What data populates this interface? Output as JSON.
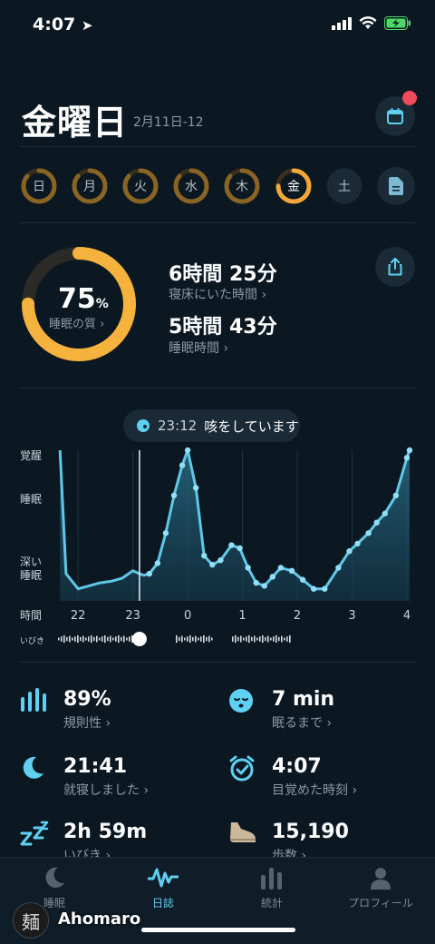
{
  "status_bar": {
    "time": "4:07"
  },
  "header": {
    "title": "金曜日",
    "date_range": "2月11日-12"
  },
  "week": {
    "days": [
      {
        "label": "日",
        "fraction": 0.86
      },
      {
        "label": "月",
        "fraction": 0.86
      },
      {
        "label": "火",
        "fraction": 0.86
      },
      {
        "label": "水",
        "fraction": 0.86
      },
      {
        "label": "木",
        "fraction": 0.86
      },
      {
        "label": "金",
        "fraction": 0.75,
        "active": true
      },
      {
        "label": "土",
        "fraction": 0
      }
    ]
  },
  "summary": {
    "quality_value": "75",
    "quality_unit": "%",
    "quality_fraction": 0.75,
    "quality_label": "睡眠の質 ›",
    "time_in_bed": "6時間 25分",
    "time_in_bed_label": "寝床にいた時間 ›",
    "time_asleep": "5時間 43分",
    "time_asleep_label": "睡眠時間 ›"
  },
  "event": {
    "time": "23:12",
    "text": "咳をしています"
  },
  "chart_data": {
    "type": "area",
    "y_categories": [
      "覚醒",
      "睡眠",
      "深い睡眠"
    ],
    "x_ticks": [
      "22",
      "23",
      "0",
      "1",
      "2",
      "3",
      "4"
    ],
    "xlabel": "時間",
    "snore_label": "いびき",
    "ylim": [
      0,
      100
    ],
    "x_hours": [
      21.67,
      21.78,
      22.0,
      22.2,
      22.4,
      22.6,
      22.8,
      23.0,
      23.12,
      23.2,
      23.3,
      23.45,
      23.6,
      23.75,
      23.9,
      24.0,
      24.15,
      24.3,
      24.45,
      24.6,
      24.8,
      24.95,
      25.1,
      25.25,
      25.4,
      25.55,
      25.7,
      25.9,
      26.1,
      26.3,
      26.5,
      26.75,
      26.95,
      27.1,
      27.3,
      27.45,
      27.6,
      27.8,
      28.0,
      28.05
    ],
    "values": [
      100,
      18,
      8,
      10,
      12,
      13,
      15,
      20,
      18,
      17,
      18,
      25,
      45,
      70,
      90,
      100,
      75,
      30,
      24,
      27,
      37,
      35,
      22,
      12,
      10,
      16,
      22,
      20,
      14,
      8,
      8,
      22,
      33,
      38,
      45,
      52,
      58,
      70,
      95,
      100
    ]
  },
  "metrics": [
    {
      "icon": "regularity-icon",
      "value": "89%",
      "label": "規則性 ›"
    },
    {
      "icon": "sleepy-face-icon",
      "value": "7 min",
      "label": "眠るまで ›"
    },
    {
      "icon": "moon-icon",
      "value": "21:41",
      "label": "就寝しました ›"
    },
    {
      "icon": "alarm-clock-icon",
      "value": "4:07",
      "label": "目覚めた時刻 ›"
    },
    {
      "icon": "snore-zzz-icon",
      "value": "2h 59m",
      "label": "いびき ›"
    },
    {
      "icon": "shoe-icon",
      "value": "15,190",
      "label": "歩数 ›"
    }
  ],
  "tabs": [
    {
      "label": "睡眠",
      "icon": "moon-icon"
    },
    {
      "label": "日誌",
      "icon": "waveform-icon",
      "active": true
    },
    {
      "label": "統計",
      "icon": "bar-chart-icon"
    },
    {
      "label": "プロフィール",
      "icon": "person-icon"
    }
  ],
  "watermark": {
    "name": "Ahomaro",
    "avatar_char": "麺"
  },
  "colors": {
    "accent": "#f5a83a",
    "chart": "#5fc8e6",
    "background": "#0b1822"
  }
}
